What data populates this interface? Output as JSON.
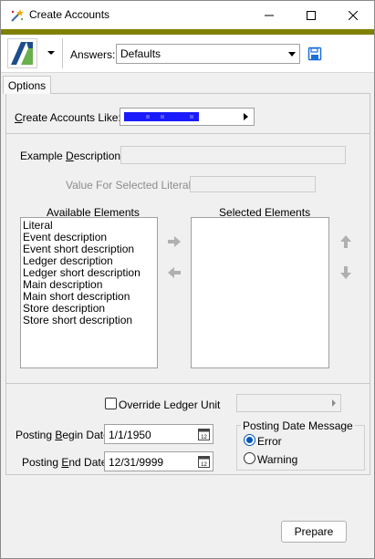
{
  "window": {
    "title": "Create Accounts",
    "accent_color": "#808000"
  },
  "toolbar": {
    "answers_label": "Answers:",
    "answers_value": "Defaults",
    "logo_icon": "app-logo",
    "save_icon": "save-icon"
  },
  "tabs": [
    {
      "label": "Options",
      "selected": true
    }
  ],
  "options": {
    "create_like_label": "Create Accounts Like:",
    "example_description_label": "Example Description:",
    "example_description_value": "",
    "value_selected_literal_label": "Value For Selected Literal:",
    "value_selected_literal_value": "",
    "available_label": "Available Elements",
    "selected_label": "Selected Elements",
    "available_items": [
      "Literal",
      "Event description",
      "Event short description",
      "Ledger description",
      "Ledger short description",
      "Main description",
      "Main short description",
      "Store description",
      "Store short description"
    ],
    "selected_items": [],
    "override_ledger_label": "Override Ledger Unit",
    "override_ledger_checked": false,
    "posting_begin_label": "Posting Begin Date:",
    "posting_begin_value": "1/1/1950",
    "posting_end_label": "Posting End Date:",
    "posting_end_value": "12/31/9999",
    "posting_message_title": "Posting Date Message",
    "posting_message_options": [
      {
        "label": "Error",
        "selected": true
      },
      {
        "label": "Warning",
        "selected": false
      }
    ],
    "calendar_day": "12"
  },
  "footer": {
    "prepare_label": "Prepare"
  }
}
